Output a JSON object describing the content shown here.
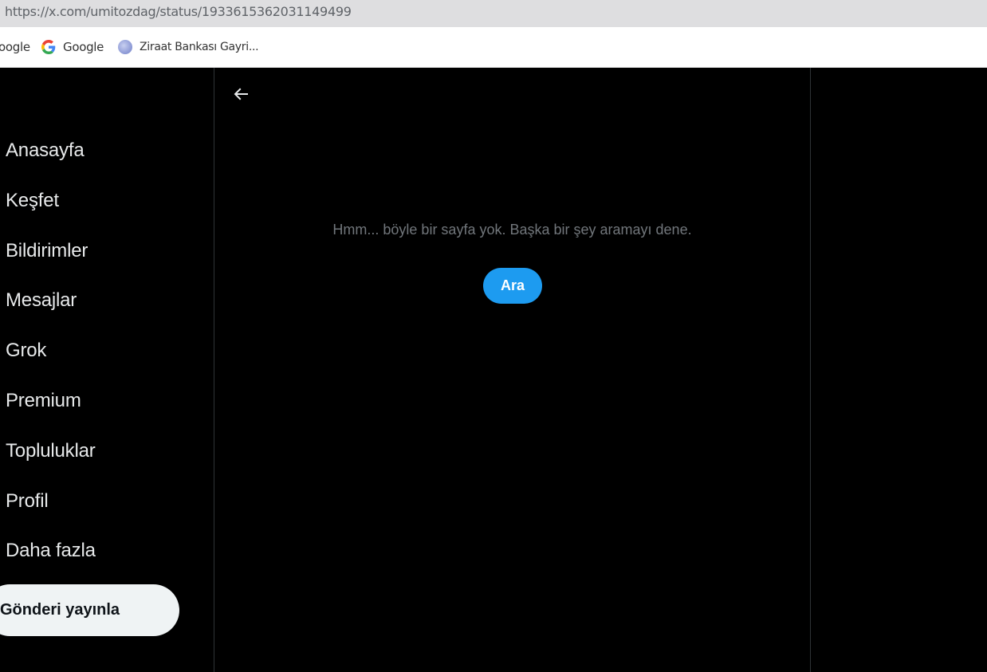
{
  "browser": {
    "url": "https://x.com/umitozdag/status/1933615362031149499",
    "bookmarks": [
      {
        "label": "oogle",
        "icon": "none"
      },
      {
        "label": "Google",
        "icon": "google-g-icon"
      },
      {
        "label": "Ziraat Bankası Gayri...",
        "icon": "globe-icon"
      }
    ]
  },
  "sidebar": {
    "items": [
      {
        "label": "Anasayfa"
      },
      {
        "label": "Keşfet"
      },
      {
        "label": "Bildirimler"
      },
      {
        "label": "Mesajlar"
      },
      {
        "label": "Grok"
      },
      {
        "label": "Premium"
      },
      {
        "label": "Topluluklar"
      },
      {
        "label": "Profil"
      },
      {
        "label": "Daha fazla"
      }
    ],
    "post_button": "Gönderi yayınla"
  },
  "main": {
    "back_icon": "arrow-left-icon",
    "error_message": "Hmm... böyle bir sayfa yok. Başka bir şey aramayı dene.",
    "search_button": "Ara"
  },
  "colors": {
    "background": "#000000",
    "accent": "#1d9bf0",
    "text_primary": "#e7e9ea",
    "text_secondary": "#71767b",
    "border": "#2f3336"
  }
}
